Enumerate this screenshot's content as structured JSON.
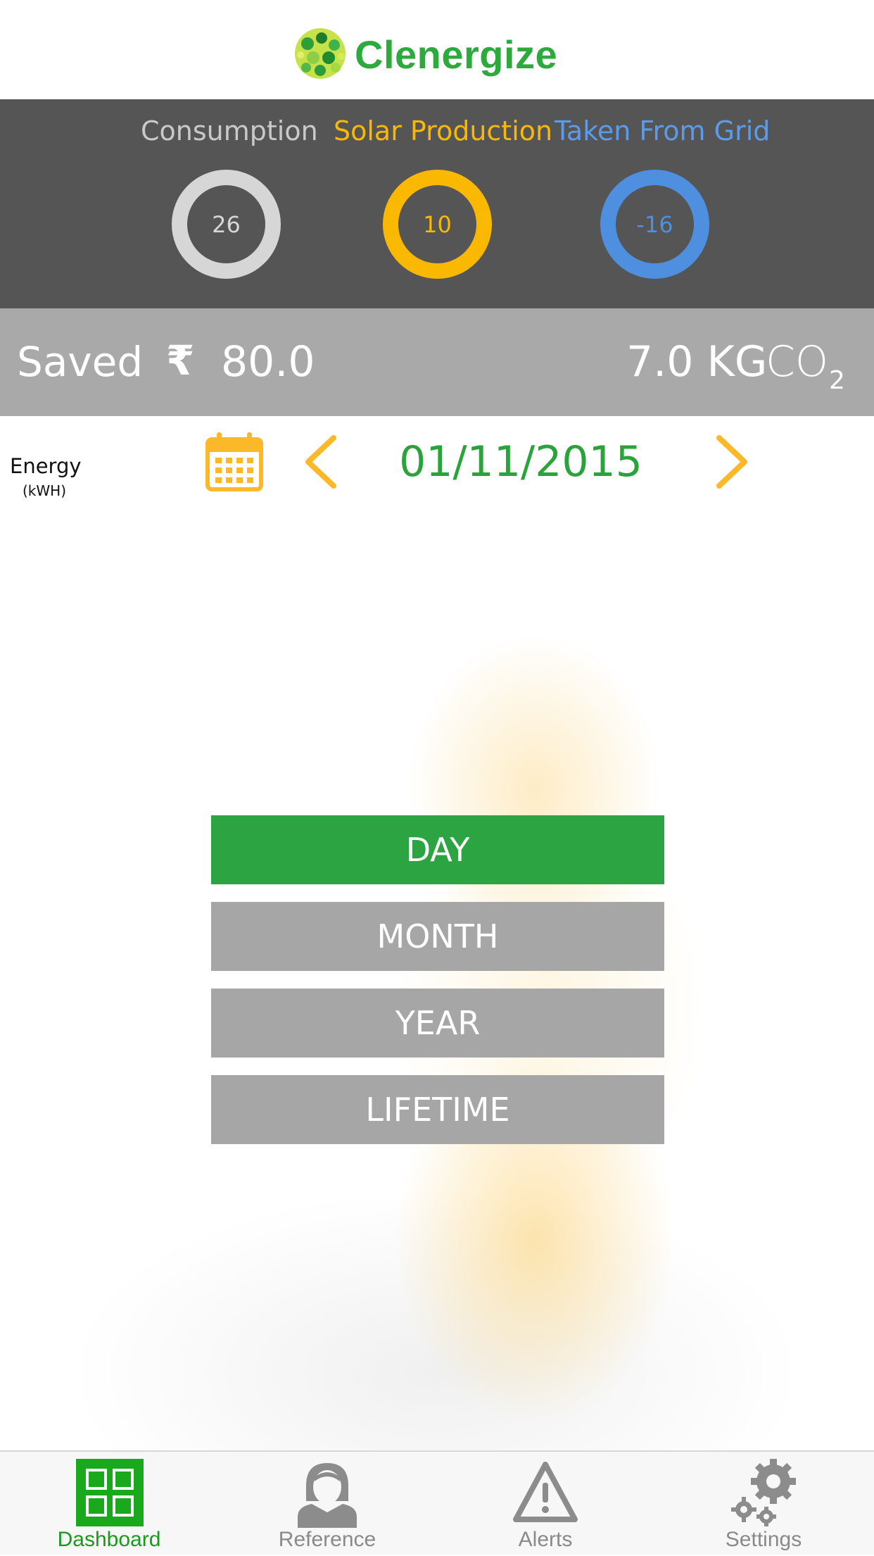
{
  "header": {
    "brand": "Clenergize"
  },
  "summary": {
    "consumption": {
      "label": "Consumption",
      "value": "26",
      "color": "#d6d6d6"
    },
    "solar": {
      "label": "Solar Production",
      "value": "10",
      "color": "#fbb800"
    },
    "grid": {
      "label": "Taken From Grid",
      "value": "-16",
      "color": "#4e8fe0"
    }
  },
  "savings": {
    "label": "Saved",
    "currency_symbol": "₹",
    "amount": "80.0",
    "co2_value": "7.0 KG",
    "co2_unit": "CO",
    "co2_subscript": "2"
  },
  "date_nav": {
    "energy_label": "Energy",
    "energy_unit": "(kWH)",
    "date": "01/11/2015",
    "icons": [
      "calendar-icon",
      "chevron-left-icon",
      "chevron-right-icon"
    ]
  },
  "range": {
    "day": "DAY",
    "month": "MONTH",
    "year": "YEAR",
    "lifetime": "LIFETIME",
    "active": "DAY"
  },
  "tabs": [
    {
      "label": "Dashboard",
      "icon": "dashboard-icon",
      "active": true
    },
    {
      "label": "Reference",
      "icon": "person-icon",
      "active": false
    },
    {
      "label": "Alerts",
      "icon": "warning-icon",
      "active": false
    },
    {
      "label": "Settings",
      "icon": "gear-icon",
      "active": false
    }
  ],
  "colors": {
    "accent_green": "#2ba441",
    "accent_orange": "#fbb829",
    "panel_dark": "#555555",
    "panel_grey": "#a9a9a9"
  }
}
